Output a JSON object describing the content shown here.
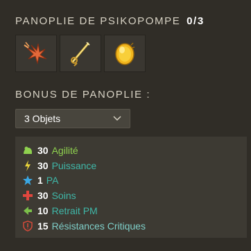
{
  "set": {
    "title": "PANOPLIE DE PSIKOPOMPE",
    "count": "0/3",
    "items": [
      {
        "icon": "orange-claw-item-icon",
        "color": "#e4693a"
      },
      {
        "icon": "golden-wand-item-icon",
        "color": "#d9b43d"
      },
      {
        "icon": "golden-orb-item-icon",
        "color": "#f1b51d"
      }
    ]
  },
  "bonus": {
    "title": "BONUS DE PANOPLIE :",
    "selected": "3 Objets",
    "lines": [
      {
        "icon": "agility-icon",
        "value": "30",
        "stat": "Agilité",
        "color": "#8fd14f"
      },
      {
        "icon": "power-icon",
        "value": "30",
        "stat": "Puissance",
        "color": "#3fb8a9"
      },
      {
        "icon": "pa-star-icon",
        "value": "1",
        "stat": "PA",
        "color": "#3fb8a9"
      },
      {
        "icon": "heal-cross-icon",
        "value": "30",
        "stat": "Soins",
        "color": "#3fb8a9"
      },
      {
        "icon": "pm-retreat-icon",
        "value": "10",
        "stat": "Retrait PM",
        "color": "#3fb8a9"
      },
      {
        "icon": "critical-resistance-shield-icon",
        "value": "15",
        "stat": "Résistances Critiques",
        "color": "#7fcfc9"
      }
    ]
  }
}
